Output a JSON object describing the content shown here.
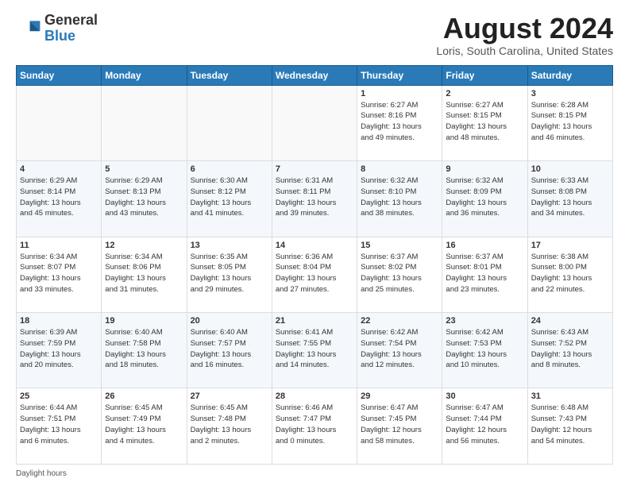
{
  "logo": {
    "general": "General",
    "blue": "Blue"
  },
  "header": {
    "month_year": "August 2024",
    "location": "Loris, South Carolina, United States"
  },
  "days_of_week": [
    "Sunday",
    "Monday",
    "Tuesday",
    "Wednesday",
    "Thursday",
    "Friday",
    "Saturday"
  ],
  "footer": {
    "daylight_label": "Daylight hours"
  },
  "weeks": [
    [
      {
        "day": "",
        "info": ""
      },
      {
        "day": "",
        "info": ""
      },
      {
        "day": "",
        "info": ""
      },
      {
        "day": "",
        "info": ""
      },
      {
        "day": "1",
        "info": "Sunrise: 6:27 AM\nSunset: 8:16 PM\nDaylight: 13 hours\nand 49 minutes."
      },
      {
        "day": "2",
        "info": "Sunrise: 6:27 AM\nSunset: 8:15 PM\nDaylight: 13 hours\nand 48 minutes."
      },
      {
        "day": "3",
        "info": "Sunrise: 6:28 AM\nSunset: 8:15 PM\nDaylight: 13 hours\nand 46 minutes."
      }
    ],
    [
      {
        "day": "4",
        "info": "Sunrise: 6:29 AM\nSunset: 8:14 PM\nDaylight: 13 hours\nand 45 minutes."
      },
      {
        "day": "5",
        "info": "Sunrise: 6:29 AM\nSunset: 8:13 PM\nDaylight: 13 hours\nand 43 minutes."
      },
      {
        "day": "6",
        "info": "Sunrise: 6:30 AM\nSunset: 8:12 PM\nDaylight: 13 hours\nand 41 minutes."
      },
      {
        "day": "7",
        "info": "Sunrise: 6:31 AM\nSunset: 8:11 PM\nDaylight: 13 hours\nand 39 minutes."
      },
      {
        "day": "8",
        "info": "Sunrise: 6:32 AM\nSunset: 8:10 PM\nDaylight: 13 hours\nand 38 minutes."
      },
      {
        "day": "9",
        "info": "Sunrise: 6:32 AM\nSunset: 8:09 PM\nDaylight: 13 hours\nand 36 minutes."
      },
      {
        "day": "10",
        "info": "Sunrise: 6:33 AM\nSunset: 8:08 PM\nDaylight: 13 hours\nand 34 minutes."
      }
    ],
    [
      {
        "day": "11",
        "info": "Sunrise: 6:34 AM\nSunset: 8:07 PM\nDaylight: 13 hours\nand 33 minutes."
      },
      {
        "day": "12",
        "info": "Sunrise: 6:34 AM\nSunset: 8:06 PM\nDaylight: 13 hours\nand 31 minutes."
      },
      {
        "day": "13",
        "info": "Sunrise: 6:35 AM\nSunset: 8:05 PM\nDaylight: 13 hours\nand 29 minutes."
      },
      {
        "day": "14",
        "info": "Sunrise: 6:36 AM\nSunset: 8:04 PM\nDaylight: 13 hours\nand 27 minutes."
      },
      {
        "day": "15",
        "info": "Sunrise: 6:37 AM\nSunset: 8:02 PM\nDaylight: 13 hours\nand 25 minutes."
      },
      {
        "day": "16",
        "info": "Sunrise: 6:37 AM\nSunset: 8:01 PM\nDaylight: 13 hours\nand 23 minutes."
      },
      {
        "day": "17",
        "info": "Sunrise: 6:38 AM\nSunset: 8:00 PM\nDaylight: 13 hours\nand 22 minutes."
      }
    ],
    [
      {
        "day": "18",
        "info": "Sunrise: 6:39 AM\nSunset: 7:59 PM\nDaylight: 13 hours\nand 20 minutes."
      },
      {
        "day": "19",
        "info": "Sunrise: 6:40 AM\nSunset: 7:58 PM\nDaylight: 13 hours\nand 18 minutes."
      },
      {
        "day": "20",
        "info": "Sunrise: 6:40 AM\nSunset: 7:57 PM\nDaylight: 13 hours\nand 16 minutes."
      },
      {
        "day": "21",
        "info": "Sunrise: 6:41 AM\nSunset: 7:55 PM\nDaylight: 13 hours\nand 14 minutes."
      },
      {
        "day": "22",
        "info": "Sunrise: 6:42 AM\nSunset: 7:54 PM\nDaylight: 13 hours\nand 12 minutes."
      },
      {
        "day": "23",
        "info": "Sunrise: 6:42 AM\nSunset: 7:53 PM\nDaylight: 13 hours\nand 10 minutes."
      },
      {
        "day": "24",
        "info": "Sunrise: 6:43 AM\nSunset: 7:52 PM\nDaylight: 13 hours\nand 8 minutes."
      }
    ],
    [
      {
        "day": "25",
        "info": "Sunrise: 6:44 AM\nSunset: 7:51 PM\nDaylight: 13 hours\nand 6 minutes."
      },
      {
        "day": "26",
        "info": "Sunrise: 6:45 AM\nSunset: 7:49 PM\nDaylight: 13 hours\nand 4 minutes."
      },
      {
        "day": "27",
        "info": "Sunrise: 6:45 AM\nSunset: 7:48 PM\nDaylight: 13 hours\nand 2 minutes."
      },
      {
        "day": "28",
        "info": "Sunrise: 6:46 AM\nSunset: 7:47 PM\nDaylight: 13 hours\nand 0 minutes."
      },
      {
        "day": "29",
        "info": "Sunrise: 6:47 AM\nSunset: 7:45 PM\nDaylight: 12 hours\nand 58 minutes."
      },
      {
        "day": "30",
        "info": "Sunrise: 6:47 AM\nSunset: 7:44 PM\nDaylight: 12 hours\nand 56 minutes."
      },
      {
        "day": "31",
        "info": "Sunrise: 6:48 AM\nSunset: 7:43 PM\nDaylight: 12 hours\nand 54 minutes."
      }
    ]
  ]
}
